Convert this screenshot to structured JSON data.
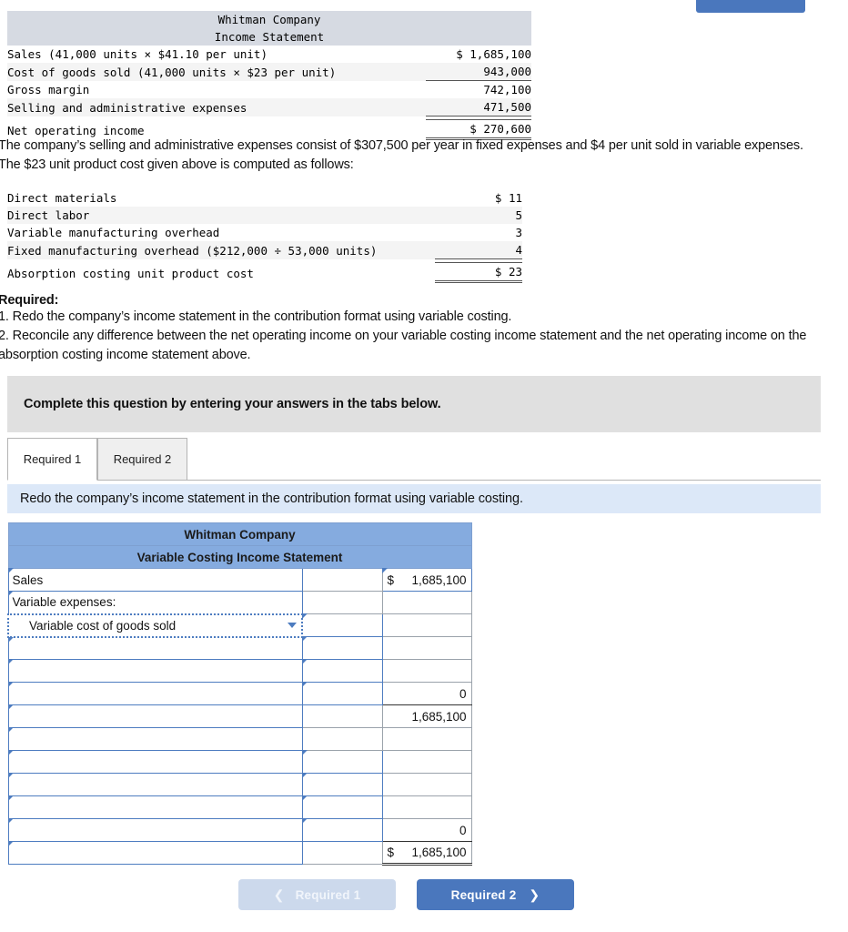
{
  "income_statement": {
    "title_line1": "Whitman Company",
    "title_line2": "Income Statement",
    "rows": [
      {
        "label": "Sales (41,000 units × $41.10 per unit)",
        "amount": "$ 1,685,100"
      },
      {
        "label": "Cost of goods sold (41,000 units × $23 per unit)",
        "amount": "943,000"
      },
      {
        "label": "Gross margin",
        "amount": "742,100"
      },
      {
        "label": "Selling and administrative expenses",
        "amount": "471,500"
      },
      {
        "label": "Net operating income",
        "amount": "$ 270,600"
      }
    ]
  },
  "paragraph": "The company’s selling and administrative expenses consist of $307,500 per year in fixed expenses and $4 per unit sold in variable expenses. The $23 unit product cost given above is computed as follows:",
  "unit_cost_table": {
    "rows": [
      {
        "label": "Direct materials",
        "amount": "$ 11"
      },
      {
        "label": "Direct labor",
        "amount": "5"
      },
      {
        "label": "Variable manufacturing overhead",
        "amount": "3"
      },
      {
        "label": "Fixed manufacturing overhead ($212,000 ÷ 53,000 units)",
        "amount": "4"
      },
      {
        "label": "Absorption costing unit product cost",
        "amount": "$ 23"
      }
    ]
  },
  "required": {
    "heading": "Required:",
    "items": [
      "1. Redo the company’s income statement in the contribution format using variable costing.",
      "2. Reconcile any difference between the net operating income on your variable costing income statement and the net operating income on the absorption costing income statement above."
    ]
  },
  "banner": {
    "text": "Complete this question by entering your answers in the tabs below."
  },
  "tabs": [
    {
      "label": "Required 1",
      "active": true
    },
    {
      "label": "Required 2",
      "active": false
    }
  ],
  "info_strip": {
    "text": "Redo the company’s income statement in the contribution format using variable costing."
  },
  "worksheet": {
    "header_line1": "Whitman Company",
    "header_line2": "Variable Costing Income Statement",
    "dropdown_arrow_icon": "chevron-down-icon",
    "rows": [
      {
        "label": "Sales",
        "col2": "",
        "col3_sign": "$",
        "col3": "1,685,100"
      },
      {
        "label": "Variable expenses:",
        "col2": "",
        "col3_sign": "",
        "col3": ""
      },
      {
        "label": "Variable cost of goods sold",
        "col2": "",
        "col3_sign": "",
        "col3": ""
      },
      {
        "label": "",
        "col2": "",
        "col3_sign": "",
        "col3": ""
      },
      {
        "label": "",
        "col2": "",
        "col3_sign": "",
        "col3": ""
      },
      {
        "label": "",
        "col2": "",
        "col3_sign": "",
        "col3": "0"
      },
      {
        "label": "",
        "col2": "",
        "col3_sign": "",
        "col3": "1,685,100"
      },
      {
        "label": "",
        "col2": "",
        "col3_sign": "",
        "col3": ""
      },
      {
        "label": "",
        "col2": "",
        "col3_sign": "",
        "col3": ""
      },
      {
        "label": "",
        "col2": "",
        "col3_sign": "",
        "col3": ""
      },
      {
        "label": "",
        "col2": "",
        "col3_sign": "",
        "col3": ""
      },
      {
        "label": "",
        "col2": "",
        "col3_sign": "",
        "col3": "0"
      },
      {
        "label": "",
        "col2": "",
        "col3_sign": "$",
        "col3": "1,685,100"
      }
    ]
  },
  "nav": {
    "prev_label": "Required 1",
    "next_label": "Required 2",
    "prev_icon": "chevron-left-icon",
    "next_icon": "chevron-right-icon"
  },
  "colors": {
    "header_blue": "#85abdf",
    "info_strip": "#dce8f8",
    "banner_grey": "#e0e0e0",
    "primary_button": "#4a77bd",
    "disabled_button": "#ccd9ec",
    "table_title_grey": "#d6dae2"
  }
}
